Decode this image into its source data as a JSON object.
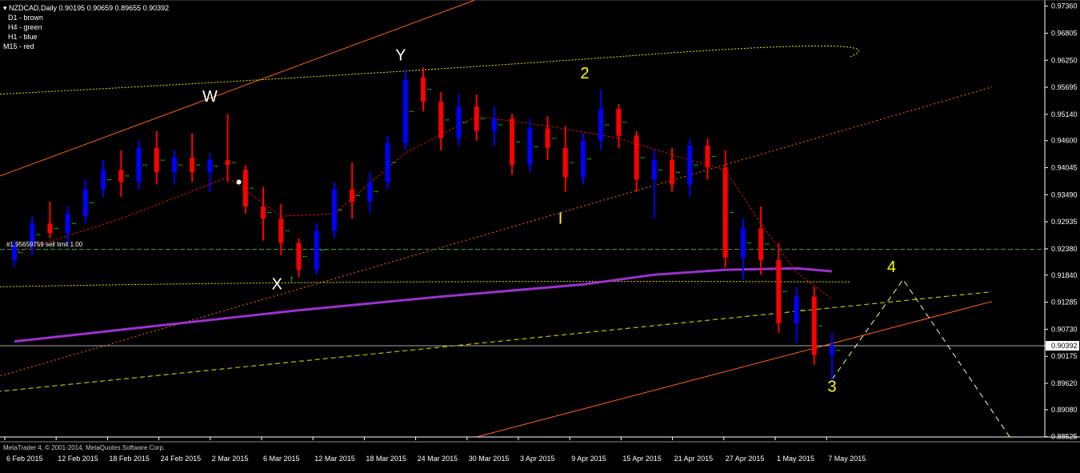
{
  "header": {
    "symbol_line": "NZDCAD,Daily  0.90195 0.90659 0.89655 0.90392",
    "legend": [
      "D1 - brown",
      "H4 - green",
      "H1 - blue",
      "M15 - red"
    ]
  },
  "status_bar": {
    "copyright": "MetaTrader 4, © 2001-2014, MetaQuotes Software Corp."
  },
  "order_label": "#1.95659759 sell limit 1.00",
  "annotations": {
    "w": "W",
    "x": "X",
    "y": "Y",
    "two": "2",
    "i": "I",
    "three": "3",
    "four": "4"
  },
  "colors": {
    "bull": "#0000ff",
    "bear": "#ff0000",
    "ma": "#9933cc",
    "channel": "#ff6a1a",
    "envelope": "#e6e600",
    "h4_marks": "#00ff00",
    "axis": "#ffffff",
    "target_path": "#ffff99"
  },
  "chart_data": {
    "type": "candlestick",
    "symbol": "NZDCAD",
    "timeframe": "Daily",
    "ohlc_current": {
      "open": 0.90195,
      "high": 0.90659,
      "low": 0.89655,
      "close": 0.90392
    },
    "ylim": [
      0.8852,
      0.9742
    ],
    "y_ticks": [
      "0.97360",
      "0.96805",
      "0.96250",
      "0.95695",
      "0.95140",
      "0.94600",
      "0.94045",
      "0.93490",
      "0.92935",
      "0.92380",
      "0.91840",
      "0.91285",
      "0.90730",
      "0.90392",
      "0.90175",
      "0.89620",
      "0.89080",
      "0.88525"
    ],
    "x_ticks": [
      "6 Feb 2015",
      "12 Feb 2015",
      "18 Feb 2015",
      "24 Feb 2015",
      "2 Mar 2015",
      "6 Mar 2015",
      "12 Mar 2015",
      "18 Mar 2015",
      "24 Mar 2015",
      "30 Mar 2015",
      "3 Apr 2015",
      "9 Apr 2015",
      "15 Apr 2015",
      "21 Apr 2015",
      "27 Apr 2015",
      "1 May 2015",
      "7 May 2015"
    ],
    "current_price": 0.90392,
    "sell_limit_level": 0.9237,
    "candles": [
      {
        "o": 0.9215,
        "h": 0.9255,
        "l": 0.92,
        "c": 0.9245
      },
      {
        "o": 0.9245,
        "h": 0.9305,
        "l": 0.9225,
        "c": 0.929
      },
      {
        "o": 0.929,
        "h": 0.9335,
        "l": 0.926,
        "c": 0.927
      },
      {
        "o": 0.927,
        "h": 0.9325,
        "l": 0.9245,
        "c": 0.931
      },
      {
        "o": 0.9305,
        "h": 0.938,
        "l": 0.929,
        "c": 0.936
      },
      {
        "o": 0.936,
        "h": 0.942,
        "l": 0.9345,
        "c": 0.94
      },
      {
        "o": 0.94,
        "h": 0.944,
        "l": 0.9345,
        "c": 0.9375
      },
      {
        "o": 0.9375,
        "h": 0.946,
        "l": 0.936,
        "c": 0.9445
      },
      {
        "o": 0.9445,
        "h": 0.948,
        "l": 0.937,
        "c": 0.9395
      },
      {
        "o": 0.9395,
        "h": 0.944,
        "l": 0.937,
        "c": 0.9425
      },
      {
        "o": 0.9425,
        "h": 0.9475,
        "l": 0.9375,
        "c": 0.9395
      },
      {
        "o": 0.9395,
        "h": 0.9435,
        "l": 0.9355,
        "c": 0.942
      },
      {
        "o": 0.942,
        "h": 0.9515,
        "l": 0.9375,
        "c": 0.941
      },
      {
        "o": 0.94,
        "h": 0.941,
        "l": 0.931,
        "c": 0.9325
      },
      {
        "o": 0.9325,
        "h": 0.9365,
        "l": 0.9255,
        "c": 0.93
      },
      {
        "o": 0.93,
        "h": 0.933,
        "l": 0.9225,
        "c": 0.925
      },
      {
        "o": 0.925,
        "h": 0.926,
        "l": 0.918,
        "c": 0.9195
      },
      {
        "o": 0.9195,
        "h": 0.929,
        "l": 0.9185,
        "c": 0.9275
      },
      {
        "o": 0.9275,
        "h": 0.9375,
        "l": 0.926,
        "c": 0.936
      },
      {
        "o": 0.936,
        "h": 0.9415,
        "l": 0.93,
        "c": 0.9335
      },
      {
        "o": 0.9335,
        "h": 0.9395,
        "l": 0.931,
        "c": 0.9375
      },
      {
        "o": 0.9375,
        "h": 0.947,
        "l": 0.936,
        "c": 0.9455
      },
      {
        "o": 0.9455,
        "h": 0.9605,
        "l": 0.944,
        "c": 0.9585
      },
      {
        "o": 0.959,
        "h": 0.961,
        "l": 0.952,
        "c": 0.954
      },
      {
        "o": 0.954,
        "h": 0.956,
        "l": 0.944,
        "c": 0.9465
      },
      {
        "o": 0.9465,
        "h": 0.9555,
        "l": 0.945,
        "c": 0.953
      },
      {
        "o": 0.953,
        "h": 0.9555,
        "l": 0.946,
        "c": 0.948
      },
      {
        "o": 0.948,
        "h": 0.953,
        "l": 0.945,
        "c": 0.9505
      },
      {
        "o": 0.9505,
        "h": 0.9515,
        "l": 0.939,
        "c": 0.941
      },
      {
        "o": 0.941,
        "h": 0.9505,
        "l": 0.9395,
        "c": 0.9485
      },
      {
        "o": 0.9485,
        "h": 0.951,
        "l": 0.942,
        "c": 0.9445
      },
      {
        "o": 0.9445,
        "h": 0.949,
        "l": 0.9355,
        "c": 0.9385
      },
      {
        "o": 0.9385,
        "h": 0.9475,
        "l": 0.937,
        "c": 0.946
      },
      {
        "o": 0.946,
        "h": 0.9565,
        "l": 0.944,
        "c": 0.9525
      },
      {
        "o": 0.9525,
        "h": 0.9535,
        "l": 0.9445,
        "c": 0.947
      },
      {
        "o": 0.947,
        "h": 0.948,
        "l": 0.9355,
        "c": 0.938
      },
      {
        "o": 0.938,
        "h": 0.944,
        "l": 0.93,
        "c": 0.942
      },
      {
        "o": 0.942,
        "h": 0.9445,
        "l": 0.9355,
        "c": 0.937
      },
      {
        "o": 0.937,
        "h": 0.9465,
        "l": 0.9345,
        "c": 0.945
      },
      {
        "o": 0.945,
        "h": 0.9465,
        "l": 0.938,
        "c": 0.9405
      },
      {
        "o": 0.9405,
        "h": 0.944,
        "l": 0.92,
        "c": 0.922
      },
      {
        "o": 0.922,
        "h": 0.93,
        "l": 0.9175,
        "c": 0.928
      },
      {
        "o": 0.928,
        "h": 0.9325,
        "l": 0.9185,
        "c": 0.9215
      },
      {
        "o": 0.9215,
        "h": 0.925,
        "l": 0.9065,
        "c": 0.9085
      },
      {
        "o": 0.9085,
        "h": 0.916,
        "l": 0.9045,
        "c": 0.914
      },
      {
        "o": 0.914,
        "h": 0.916,
        "l": 0.9,
        "c": 0.902
      },
      {
        "o": 0.902,
        "h": 0.9066,
        "l": 0.8966,
        "c": 0.9039
      }
    ],
    "moving_average": [
      [
        0,
        0.9048
      ],
      [
        8,
        0.908
      ],
      [
        16,
        0.9112
      ],
      [
        24,
        0.914
      ],
      [
        32,
        0.9165
      ],
      [
        36,
        0.9185
      ],
      [
        40,
        0.9195
      ],
      [
        44,
        0.9198
      ],
      [
        46,
        0.9192
      ]
    ],
    "fast_ma": [
      [
        0,
        0.923
      ],
      [
        6,
        0.93
      ],
      [
        12,
        0.9385
      ],
      [
        15,
        0.9305
      ],
      [
        18,
        0.931
      ],
      [
        22,
        0.9435
      ],
      [
        26,
        0.951
      ],
      [
        30,
        0.949
      ],
      [
        34,
        0.9465
      ],
      [
        38,
        0.942
      ],
      [
        40,
        0.94
      ],
      [
        42,
        0.929
      ],
      [
        44,
        0.919
      ],
      [
        46,
        0.9135
      ]
    ],
    "target_path": [
      [
        46,
        0.897
      ],
      [
        50,
        0.9175
      ],
      [
        56,
        0.8852
      ]
    ],
    "channel_lines": [
      {
        "from": [
          -1,
          0.9385
        ],
        "to": [
          29,
          0.979
        ]
      },
      {
        "from": [
          26,
          0.8852
        ],
        "to": [
          55,
          0.913
        ]
      }
    ],
    "dotted_lines": [
      {
        "from": [
          -1,
          0.8975
        ],
        "to": [
          55,
          0.957
        ]
      }
    ],
    "envelope_lines": [
      {
        "from": [
          -1,
          0.9555
        ],
        "to": [
          20,
          0.9595
        ],
        "mid": [
          35,
          0.9635
        ],
        "end": [
          47,
          0.9632
        ]
      },
      {
        "from": [
          -1,
          0.916
        ],
        "to": [
          47,
          0.917
        ]
      }
    ],
    "yellow_trend": [
      {
        "from": [
          -1,
          0.8945
        ],
        "to": [
          55,
          0.915
        ]
      }
    ]
  }
}
